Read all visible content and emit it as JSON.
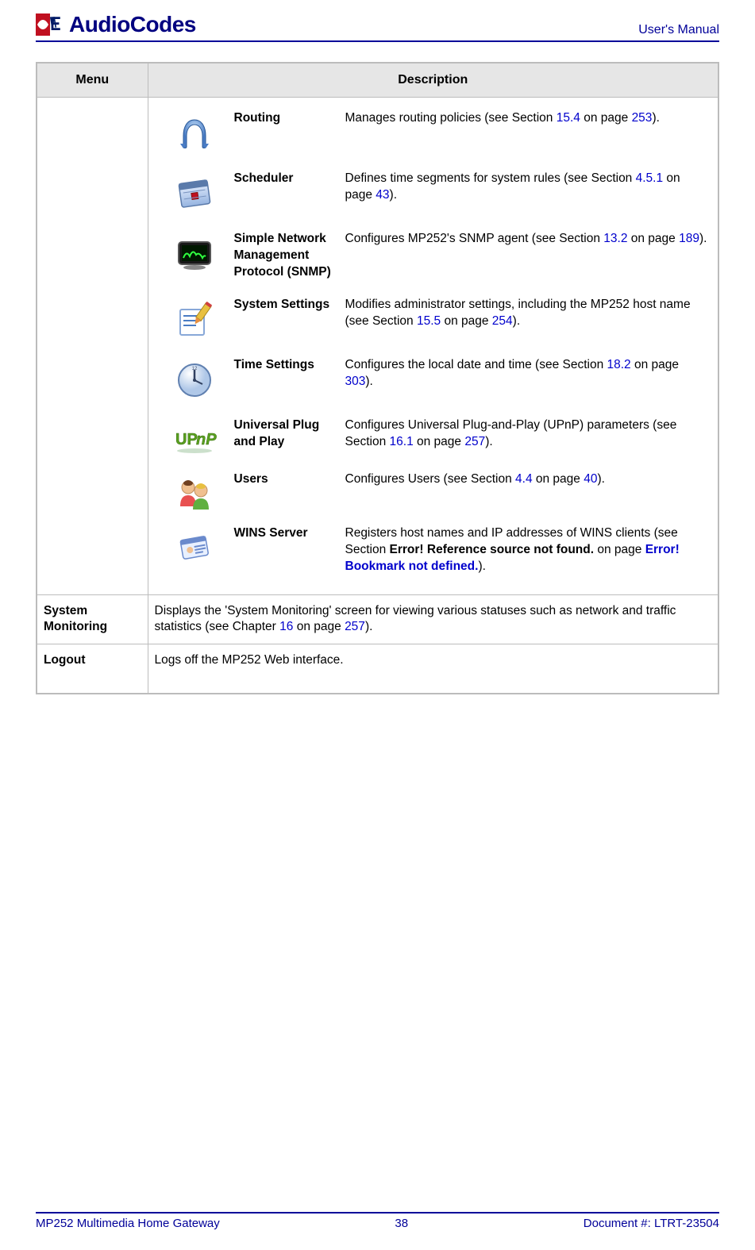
{
  "header": {
    "brand": "AudioCodes",
    "right": "User's Manual"
  },
  "table": {
    "col_menu": "Menu",
    "col_desc": "Description",
    "items": [
      {
        "label": "Routing",
        "desc_parts": [
          "Manages routing policies (see Section ",
          "15.4",
          " on page ",
          "253",
          ")."
        ],
        "icon": "routing-icon"
      },
      {
        "label": "Scheduler",
        "desc_parts": [
          "Defines time segments for system rules (see Section ",
          "4.5.1",
          " on page ",
          "43",
          ")."
        ],
        "icon": "scheduler-icon"
      },
      {
        "label": "Simple Network Management Protocol (SNMP)",
        "desc_parts": [
          "Configures MP252's SNMP agent (see Section ",
          "13.2",
          " on page ",
          "189",
          ")."
        ],
        "icon": "snmp-icon"
      },
      {
        "label": "System Settings",
        "desc_parts": [
          "Modifies administrator settings, including the MP252 host name (see Section ",
          "15.5",
          " on page ",
          "254",
          ")."
        ],
        "icon": "system-settings-icon"
      },
      {
        "label": "Time Settings",
        "desc_parts": [
          "Configures the local date and time (see Section ",
          "18.2",
          " on page ",
          "303",
          ")."
        ],
        "icon": "time-settings-icon"
      },
      {
        "label": "Universal Plug and Play",
        "desc_parts": [
          "Configures Universal Plug-and-Play (UPnP) parameters (see Section ",
          "16.1",
          " on page ",
          "257",
          ")."
        ],
        "icon": "upnp-icon"
      },
      {
        "label": "Users",
        "desc_parts": [
          "Configures Users (see Section ",
          "4.4",
          " on page ",
          "40",
          ")."
        ],
        "icon": "users-icon"
      },
      {
        "label": "WINS Server",
        "desc_parts_wins": {
          "a": "Registers host names and IP addresses of WINS clients (see Section ",
          "b": "Error! Reference source not found.",
          "c": " on page ",
          "d": "Error! Bookmark not defined.",
          "e": ")."
        },
        "icon": "wins-icon"
      }
    ],
    "sysmon_label": "System Monitoring",
    "sysmon_desc_parts": [
      "Displays the 'System Monitoring' screen for viewing various statuses such as network and traffic statistics (see Chapter ",
      "16",
      " on page ",
      "257",
      ")."
    ],
    "logout_label": "Logout",
    "logout_desc": "Logs off the MP252 Web interface."
  },
  "footer": {
    "left": "MP252 Multimedia Home Gateway",
    "center": "38",
    "right": "Document #: LTRT-23504"
  }
}
